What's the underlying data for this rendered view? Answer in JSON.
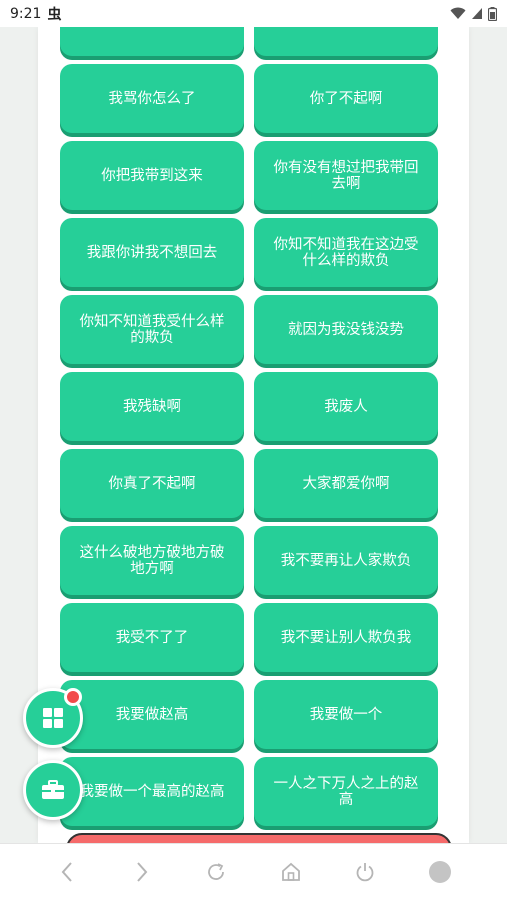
{
  "status_bar": {
    "time": "9:21",
    "notification_glyph": "虫"
  },
  "buttons": [
    "",
    "",
    "我骂你怎么了",
    "你了不起啊",
    "你把我带到这来",
    "你有没有想过把我带回去啊",
    "我跟你讲我不想回去",
    "你知不知道我在这边受什么样的欺负",
    "你知不知道我受什么样的欺负",
    "就因为我没钱没势",
    "我残缺啊",
    "我废人",
    "你真了不起啊",
    "大家都爱你啊",
    "这什么破地方破地方破地方啊",
    "我不要再让人家欺负",
    "我受不了了",
    "我不要让别人欺负我",
    "我要做赵高",
    "我要做一个",
    "我要做一个最高的赵高",
    "一人之下万人之上的赵高"
  ],
  "colors": {
    "button": "#26cf98",
    "button_shadow": "#1a9e72",
    "badge": "#f24b4b",
    "bottom_button": "#f56a6a"
  },
  "icons": {
    "fab_top": "apps-grid-icon",
    "fab_bottom": "toolbox-icon",
    "nav": [
      "back-icon",
      "forward-icon",
      "refresh-icon",
      "home-icon",
      "power-icon",
      "tabs-icon"
    ]
  }
}
